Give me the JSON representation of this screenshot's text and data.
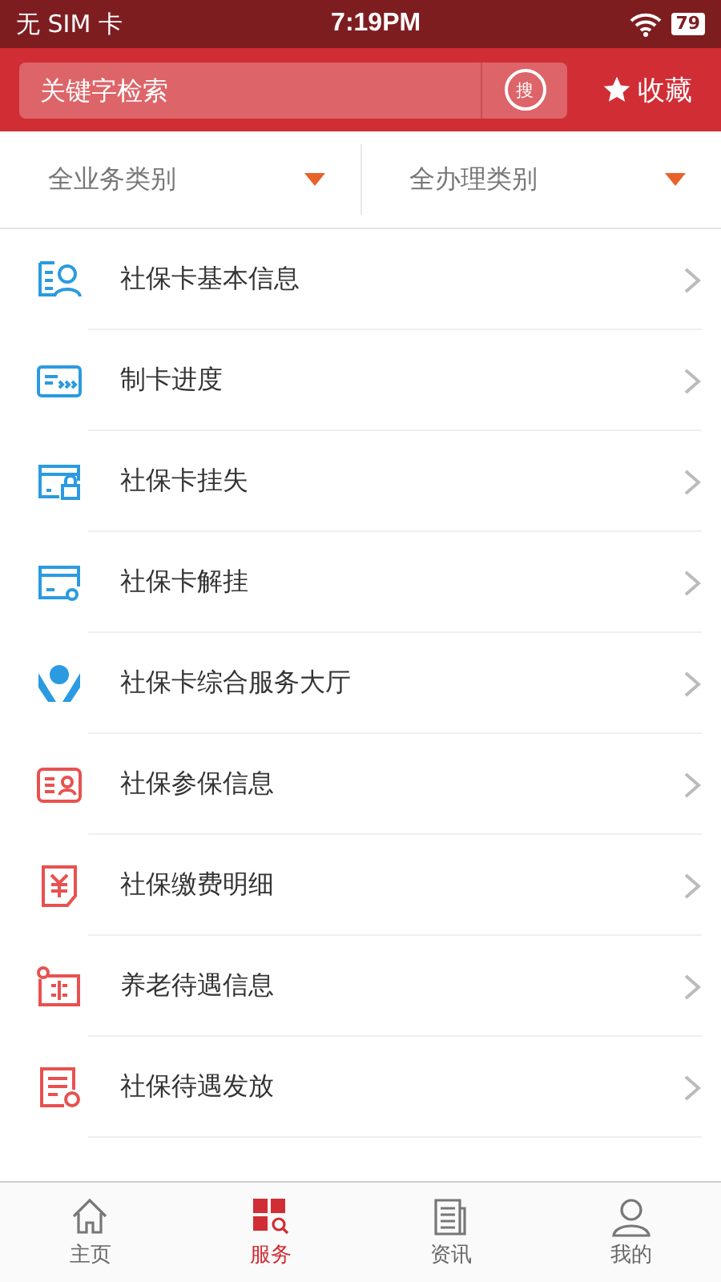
{
  "status_bar": {
    "carrier": "无 SIM 卡",
    "time": "7:19PM",
    "battery": "79"
  },
  "header": {
    "search": {
      "placeholder": "关键字检索",
      "button": "搜"
    },
    "favorite": "收藏"
  },
  "filters": [
    {
      "label": "全业务类别"
    },
    {
      "label": "全办理类别"
    }
  ],
  "services": [
    {
      "label": "社保卡基本信息",
      "color": "#2a9be0"
    },
    {
      "label": "制卡进度",
      "color": "#2a9be0"
    },
    {
      "label": "社保卡挂失",
      "color": "#2a9be0"
    },
    {
      "label": "社保卡解挂",
      "color": "#2a9be0"
    },
    {
      "label": "社保卡综合服务大厅",
      "color": "#2a9be0"
    },
    {
      "label": "社保参保信息",
      "color": "#e8514f"
    },
    {
      "label": "社保缴费明细",
      "color": "#e8514f"
    },
    {
      "label": "养老待遇信息",
      "color": "#e8514f"
    },
    {
      "label": "社保待遇发放",
      "color": "#e8514f"
    }
  ],
  "tabs": [
    {
      "label": "主页",
      "selected": false
    },
    {
      "label": "服务",
      "selected": true
    },
    {
      "label": "资讯",
      "selected": false
    },
    {
      "label": "我的",
      "selected": false
    }
  ]
}
